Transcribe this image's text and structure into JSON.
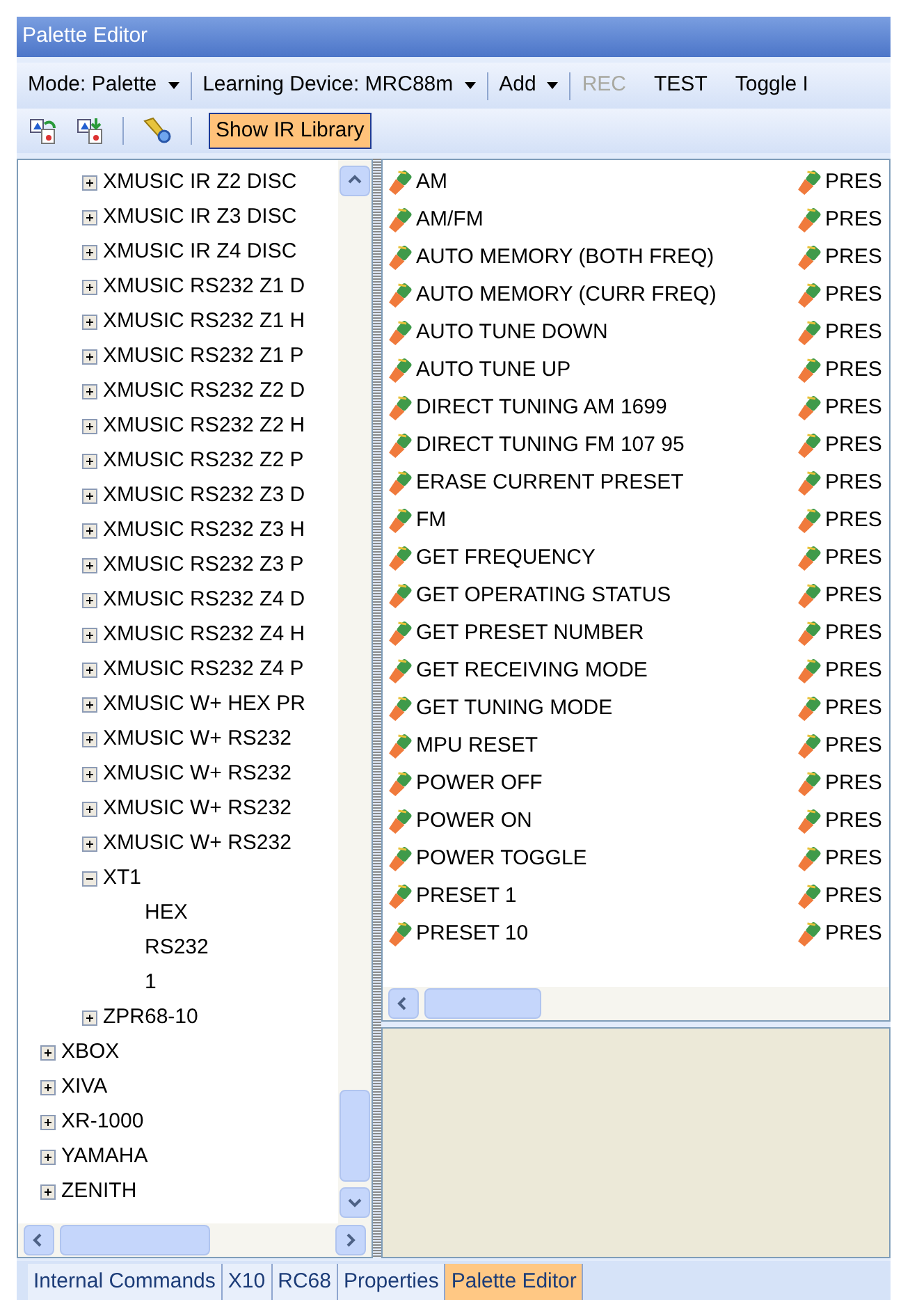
{
  "window": {
    "title": "Palette Editor"
  },
  "toolbar": {
    "items": [
      {
        "kind": "dropdown",
        "label": "Mode: Palette",
        "disabled": false
      },
      {
        "kind": "dropdown",
        "label": "Learning Device: MRC88m",
        "disabled": false
      },
      {
        "kind": "dropdown",
        "label": "Add",
        "disabled": false
      },
      {
        "kind": "button",
        "label": "REC",
        "disabled": true
      },
      {
        "kind": "button",
        "label": "TEST",
        "disabled": false
      },
      {
        "kind": "button",
        "label": "Toggle I",
        "disabled": false
      }
    ]
  },
  "toolbar2": {
    "show_ir_library": {
      "label": "Show IR Library",
      "checked": true
    }
  },
  "tree": {
    "nested_items": [
      {
        "label": "XMUSIC IR Z2 DISC",
        "expanded": false
      },
      {
        "label": "XMUSIC IR Z3 DISC",
        "expanded": false
      },
      {
        "label": "XMUSIC IR Z4 DISC",
        "expanded": false
      },
      {
        "label": "XMUSIC RS232 Z1 D",
        "expanded": false
      },
      {
        "label": "XMUSIC RS232 Z1 H",
        "expanded": false
      },
      {
        "label": "XMUSIC RS232 Z1 P",
        "expanded": false
      },
      {
        "label": "XMUSIC RS232 Z2 D",
        "expanded": false
      },
      {
        "label": "XMUSIC RS232 Z2 H",
        "expanded": false
      },
      {
        "label": "XMUSIC RS232 Z2 P",
        "expanded": false
      },
      {
        "label": "XMUSIC RS232 Z3 D",
        "expanded": false
      },
      {
        "label": "XMUSIC RS232 Z3 H",
        "expanded": false
      },
      {
        "label": "XMUSIC RS232 Z3 P",
        "expanded": false
      },
      {
        "label": "XMUSIC RS232 Z4 D",
        "expanded": false
      },
      {
        "label": "XMUSIC RS232 Z4 H",
        "expanded": false
      },
      {
        "label": "XMUSIC RS232 Z4 P",
        "expanded": false
      },
      {
        "label": "XMUSIC W+ HEX PR",
        "expanded": false
      },
      {
        "label": "XMUSIC W+ RS232",
        "expanded": false
      },
      {
        "label": "XMUSIC W+ RS232",
        "expanded": false
      },
      {
        "label": "XMUSIC W+ RS232",
        "expanded": false
      },
      {
        "label": "XMUSIC W+ RS232",
        "expanded": false
      },
      {
        "label": "XT1",
        "expanded": true,
        "children": [
          {
            "label": "HEX"
          },
          {
            "label": "RS232"
          },
          {
            "label": "1"
          }
        ]
      },
      {
        "label": "ZPR68-10",
        "expanded": false
      }
    ],
    "items": [
      {
        "label": "XBOX",
        "expanded": false
      },
      {
        "label": "XIVA",
        "expanded": false
      },
      {
        "label": "XR-1000",
        "expanded": false
      },
      {
        "label": "YAMAHA",
        "expanded": false
      },
      {
        "label": "ZENITH",
        "expanded": false
      }
    ]
  },
  "commands": {
    "column_1": [
      "AM",
      "AM/FM",
      "AUTO MEMORY (BOTH FREQ)",
      "AUTO MEMORY (CURR FREQ)",
      "AUTO TUNE DOWN",
      "AUTO TUNE UP",
      "DIRECT TUNING AM 1699",
      "DIRECT TUNING FM 107 95",
      "ERASE CURRENT PRESET",
      "FM",
      "GET FREQUENCY",
      "GET OPERATING STATUS",
      "GET PRESET NUMBER",
      "GET RECEIVING MODE",
      "GET TUNING MODE",
      "MPU RESET",
      "POWER OFF",
      "POWER ON",
      "POWER TOGGLE",
      "PRESET 1",
      "PRESET 10"
    ],
    "column_2": [
      "PRES",
      "PRES",
      "PRES",
      "PRES",
      "PRES",
      "PRES",
      "PRES",
      "PRES",
      "PRES",
      "PRES",
      "PRES",
      "PRES",
      "PRES",
      "PRES",
      "PRES",
      "PRES",
      "PRES",
      "PRES",
      "PRES",
      "PRES",
      "PRES"
    ]
  },
  "tabs": [
    {
      "label": "Internal Commands",
      "selected": false
    },
    {
      "label": "X10",
      "selected": false
    },
    {
      "label": "RC68",
      "selected": false
    },
    {
      "label": "Properties",
      "selected": false
    },
    {
      "label": "Palette Editor",
      "selected": true
    }
  ]
}
